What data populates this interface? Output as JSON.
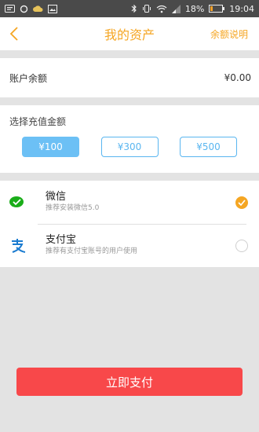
{
  "status_bar": {
    "battery_percent": "18%",
    "time": "19:04"
  },
  "header": {
    "title": "我的资产",
    "right_link": "余额说明"
  },
  "balance": {
    "label": "账户余额",
    "value": "¥0.00"
  },
  "recharge": {
    "label": "选择充值金额",
    "amounts": [
      {
        "label": "¥100",
        "selected": true
      },
      {
        "label": "¥300",
        "selected": false
      },
      {
        "label": "¥500",
        "selected": false
      }
    ]
  },
  "payment_methods": [
    {
      "name": "微信",
      "desc": "推荐安装微信5.0",
      "icon": "wechat-pay-icon",
      "selected": true
    },
    {
      "name": "支付宝",
      "desc": "推荐有支付宝账号的用户使用",
      "icon": "alipay-icon",
      "selected": false
    }
  ],
  "pay_button": {
    "label": "立即支付"
  },
  "colors": {
    "accent": "#f5a623",
    "blue": "#5ab6f0",
    "pay_button": "#f8484a",
    "wechat_green": "#1aad19",
    "alipay_blue": "#1a7bd0"
  }
}
